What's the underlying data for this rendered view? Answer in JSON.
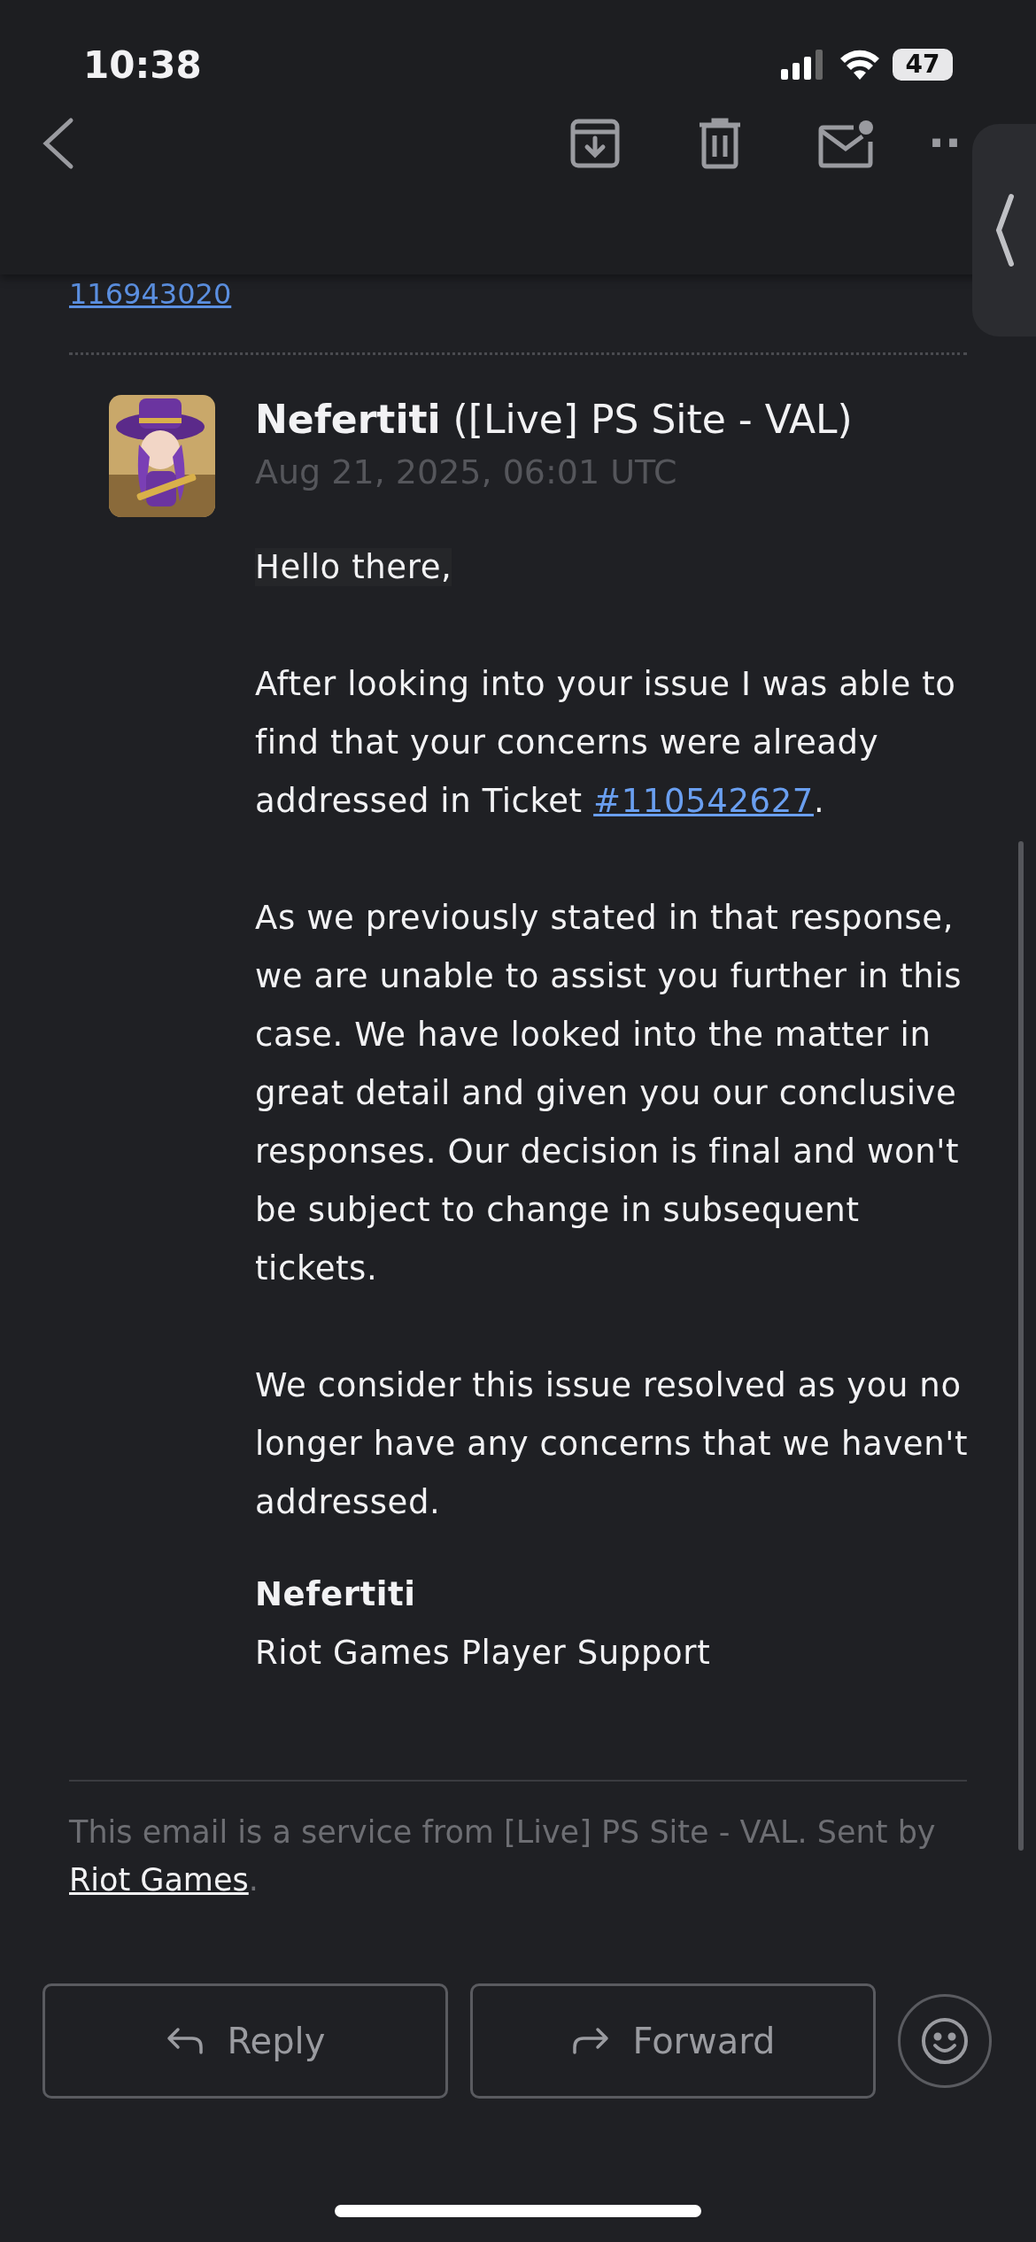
{
  "status_bar": {
    "time": "10:38",
    "battery": "47"
  },
  "hidden_message": {
    "url_tail": "116943020"
  },
  "toolbar": {
    "more": "··"
  },
  "message": {
    "sender": "Nefertiti",
    "sender_source": "([Live] PS Site - VAL)",
    "date": "Aug 21, 2025, 06:01 UTC",
    "greeting": "Hello there,",
    "paragraphs": [
      {
        "before": "After looking into your issue I was able to find that your concerns were already addressed in Ticket ",
        "link": "#110542627",
        "after": "."
      },
      {
        "before": "As we previously stated in that response, we are unable to assist you further in this case. We have looked into the matter in great detail and given you our conclusive responses. Our decision is final and won't be subject to change in subsequent tickets."
      },
      {
        "before": "We consider this issue resolved as you no longer have any concerns that we haven't addressed."
      }
    ],
    "signature_name": "Nefertiti",
    "signature_team": "Riot Games Player Support"
  },
  "footer": {
    "text": "This email is a service from [Live] PS Site - VAL. Sent by ",
    "link": "Riot Games",
    "after": "."
  },
  "actions": [
    {
      "label": "Reply",
      "kind": "reply"
    },
    {
      "label": "Forward",
      "kind": "forward"
    }
  ]
}
